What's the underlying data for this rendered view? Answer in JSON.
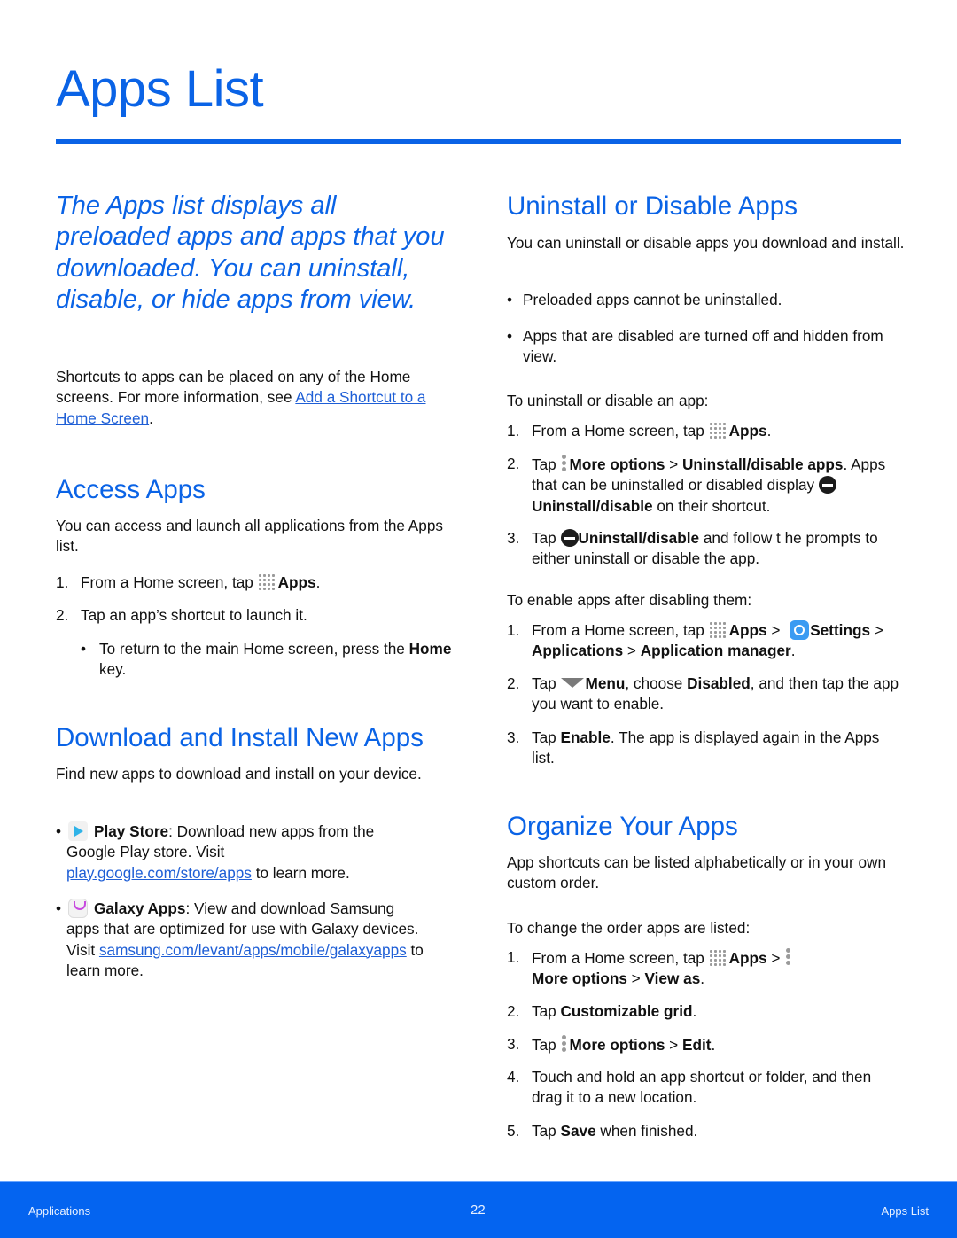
{
  "page": {
    "title": "Apps List",
    "accent_color": "#0a63e6"
  },
  "left": {
    "intro": "The Apps list displays all preloaded apps and apps that you downloaded. You can uninstall, disable, or hide apps from view.",
    "shortcuts_text": "Shortcuts to apps can be placed on any of the Home screens. For more information, see ",
    "shortcuts_link": "Add a Shortcut to a Home Screen",
    "shortcuts_end": ".",
    "access": {
      "heading": "Access Apps",
      "body": "You can access and launch all applications from the Apps list.",
      "steps": [
        {
          "num": "1.",
          "pre": "From a Home screen, tap ",
          "icon": "apps-grid-icon",
          "bold": "Apps",
          "post": "."
        },
        {
          "num": "2.",
          "text": "Tap an app’s shortcut to launch it."
        }
      ],
      "sub_bullet": {
        "pre": "To return to the main Home screen, press the ",
        "bold": "Home",
        "post": " key."
      }
    },
    "download": {
      "heading": "Download and Install New Apps",
      "body": "Find new apps to download and install on your device.",
      "items": [
        {
          "icon": "play-store-icon",
          "bold": "Play Store",
          "text": ": Download new apps from the Google Play store. Visit ",
          "link": "play.google.com/store/apps",
          "post": " to learn more."
        },
        {
          "icon": "galaxy-apps-icon",
          "bold": "Galaxy Apps",
          "text": ": View and download Samsung apps that are optimized for use with Galaxy devices. Visit ",
          "link": "samsung.com/levant/apps/mobile/galaxyapps",
          "post": " to learn more."
        }
      ]
    }
  },
  "right": {
    "uninstall": {
      "heading": "Uninstall or Disable Apps",
      "body": "You can uninstall or disable apps you download and install.",
      "bullets": [
        "Preloaded apps cannot be uninstalled.",
        "Apps that are disabled are turned off and hidden from view."
      ],
      "intro1": "To uninstall or disable an app:",
      "steps1": {
        "s1": {
          "num": "1.",
          "pre": "From a Home screen, tap ",
          "bold": "Apps",
          "post": "."
        },
        "s2": {
          "num": "2.",
          "pre": "Tap ",
          "bold1": "More options",
          "sep": " > ",
          "bold2": "Uninstall/disable apps",
          "mid": ". Apps that can be uninstalled or disabled display ",
          "bold3": "Uninstall/disable",
          "post": " on their shortcut."
        },
        "s3": {
          "num": "3.",
          "pre": "Tap ",
          "bold": "Uninstall/disable",
          "post": " and follow t he prompts to either uninstall or disable the app."
        }
      },
      "intro2": "To enable apps after disabling them:",
      "steps2": {
        "s1": {
          "num": "1.",
          "pre": "From a Home screen, tap ",
          "bold1": "Apps",
          "sep1": " > ",
          "bold2": "Settings",
          "sep2": " > ",
          "bold3": "Applications",
          "sep3": " > ",
          "bold4": "Application manager",
          "post": "."
        },
        "s2": {
          "num": "2.",
          "pre": "Tap ",
          "bold1": "Menu",
          "mid": ", choose ",
          "bold2": "Disabled",
          "post": ", and then tap the app you want to enable."
        },
        "s3": {
          "num": "3.",
          "pre": "Tap ",
          "bold": "Enable",
          "post": ". The app is displayed again in the Apps list."
        }
      }
    },
    "organize": {
      "heading": "Organize Your Apps",
      "body": "App shortcuts can be listed alphabetically or in your own custom order.",
      "intro": "To change the order apps are listed:",
      "steps": {
        "s1": {
          "num": "1.",
          "pre": "From a Home screen, tap ",
          "bold1": "Apps",
          "sep1": " > ",
          "bold2": "More options",
          "sep2": " > ",
          "bold3": "View as",
          "post": "."
        },
        "s2": {
          "num": "2.",
          "pre": "Tap ",
          "bold": "Customizable grid",
          "post": "."
        },
        "s3": {
          "num": "3.",
          "pre": "Tap ",
          "bold1": "More options",
          "sep": " > ",
          "bold2": "Edit",
          "post": "."
        },
        "s4": {
          "num": "4.",
          "text": "Touch and hold an app shortcut or folder, and then drag it to a new location."
        },
        "s5": {
          "num": "5.",
          "pre": "Tap ",
          "bold": "Save",
          "post": " when finished."
        }
      }
    }
  },
  "footer": {
    "section": "Applications",
    "page_number": "22",
    "chapter": "Apps List",
    "background": "#0464f0"
  }
}
